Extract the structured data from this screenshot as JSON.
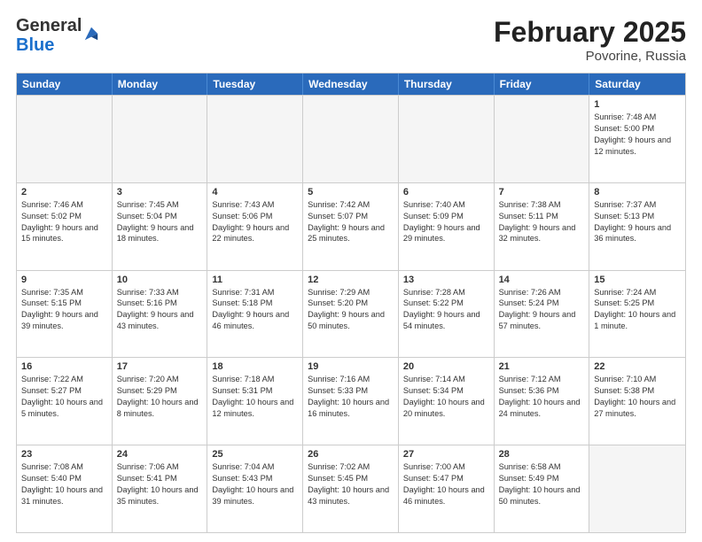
{
  "header": {
    "logo_general": "General",
    "logo_blue": "Blue",
    "month_year": "February 2025",
    "location": "Povorine, Russia"
  },
  "days_of_week": [
    "Sunday",
    "Monday",
    "Tuesday",
    "Wednesday",
    "Thursday",
    "Friday",
    "Saturday"
  ],
  "weeks": [
    [
      {
        "day": "",
        "info": ""
      },
      {
        "day": "",
        "info": ""
      },
      {
        "day": "",
        "info": ""
      },
      {
        "day": "",
        "info": ""
      },
      {
        "day": "",
        "info": ""
      },
      {
        "day": "",
        "info": ""
      },
      {
        "day": "1",
        "info": "Sunrise: 7:48 AM\nSunset: 5:00 PM\nDaylight: 9 hours and 12 minutes."
      }
    ],
    [
      {
        "day": "2",
        "info": "Sunrise: 7:46 AM\nSunset: 5:02 PM\nDaylight: 9 hours and 15 minutes."
      },
      {
        "day": "3",
        "info": "Sunrise: 7:45 AM\nSunset: 5:04 PM\nDaylight: 9 hours and 18 minutes."
      },
      {
        "day": "4",
        "info": "Sunrise: 7:43 AM\nSunset: 5:06 PM\nDaylight: 9 hours and 22 minutes."
      },
      {
        "day": "5",
        "info": "Sunrise: 7:42 AM\nSunset: 5:07 PM\nDaylight: 9 hours and 25 minutes."
      },
      {
        "day": "6",
        "info": "Sunrise: 7:40 AM\nSunset: 5:09 PM\nDaylight: 9 hours and 29 minutes."
      },
      {
        "day": "7",
        "info": "Sunrise: 7:38 AM\nSunset: 5:11 PM\nDaylight: 9 hours and 32 minutes."
      },
      {
        "day": "8",
        "info": "Sunrise: 7:37 AM\nSunset: 5:13 PM\nDaylight: 9 hours and 36 minutes."
      }
    ],
    [
      {
        "day": "9",
        "info": "Sunrise: 7:35 AM\nSunset: 5:15 PM\nDaylight: 9 hours and 39 minutes."
      },
      {
        "day": "10",
        "info": "Sunrise: 7:33 AM\nSunset: 5:16 PM\nDaylight: 9 hours and 43 minutes."
      },
      {
        "day": "11",
        "info": "Sunrise: 7:31 AM\nSunset: 5:18 PM\nDaylight: 9 hours and 46 minutes."
      },
      {
        "day": "12",
        "info": "Sunrise: 7:29 AM\nSunset: 5:20 PM\nDaylight: 9 hours and 50 minutes."
      },
      {
        "day": "13",
        "info": "Sunrise: 7:28 AM\nSunset: 5:22 PM\nDaylight: 9 hours and 54 minutes."
      },
      {
        "day": "14",
        "info": "Sunrise: 7:26 AM\nSunset: 5:24 PM\nDaylight: 9 hours and 57 minutes."
      },
      {
        "day": "15",
        "info": "Sunrise: 7:24 AM\nSunset: 5:25 PM\nDaylight: 10 hours and 1 minute."
      }
    ],
    [
      {
        "day": "16",
        "info": "Sunrise: 7:22 AM\nSunset: 5:27 PM\nDaylight: 10 hours and 5 minutes."
      },
      {
        "day": "17",
        "info": "Sunrise: 7:20 AM\nSunset: 5:29 PM\nDaylight: 10 hours and 8 minutes."
      },
      {
        "day": "18",
        "info": "Sunrise: 7:18 AM\nSunset: 5:31 PM\nDaylight: 10 hours and 12 minutes."
      },
      {
        "day": "19",
        "info": "Sunrise: 7:16 AM\nSunset: 5:33 PM\nDaylight: 10 hours and 16 minutes."
      },
      {
        "day": "20",
        "info": "Sunrise: 7:14 AM\nSunset: 5:34 PM\nDaylight: 10 hours and 20 minutes."
      },
      {
        "day": "21",
        "info": "Sunrise: 7:12 AM\nSunset: 5:36 PM\nDaylight: 10 hours and 24 minutes."
      },
      {
        "day": "22",
        "info": "Sunrise: 7:10 AM\nSunset: 5:38 PM\nDaylight: 10 hours and 27 minutes."
      }
    ],
    [
      {
        "day": "23",
        "info": "Sunrise: 7:08 AM\nSunset: 5:40 PM\nDaylight: 10 hours and 31 minutes."
      },
      {
        "day": "24",
        "info": "Sunrise: 7:06 AM\nSunset: 5:41 PM\nDaylight: 10 hours and 35 minutes."
      },
      {
        "day": "25",
        "info": "Sunrise: 7:04 AM\nSunset: 5:43 PM\nDaylight: 10 hours and 39 minutes."
      },
      {
        "day": "26",
        "info": "Sunrise: 7:02 AM\nSunset: 5:45 PM\nDaylight: 10 hours and 43 minutes."
      },
      {
        "day": "27",
        "info": "Sunrise: 7:00 AM\nSunset: 5:47 PM\nDaylight: 10 hours and 46 minutes."
      },
      {
        "day": "28",
        "info": "Sunrise: 6:58 AM\nSunset: 5:49 PM\nDaylight: 10 hours and 50 minutes."
      },
      {
        "day": "",
        "info": ""
      }
    ]
  ]
}
